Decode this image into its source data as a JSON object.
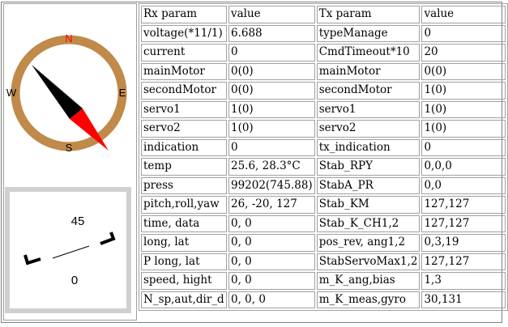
{
  "compass": {
    "north": "N",
    "south": "S",
    "east": "E",
    "west": "W",
    "ring_color": "#c08a4a",
    "needle_north_color": "#000000",
    "needle_south_color": "#ff0000",
    "north_label_color": "#ff0000",
    "heading_deg": -42
  },
  "attitude": {
    "pitch_label": "45",
    "zero_label": "0"
  },
  "table": {
    "headers": [
      "Rx param",
      "value",
      "Tx param",
      "value"
    ],
    "rows": [
      [
        "voltage(*11/1)",
        "6.688",
        "typeManage",
        "0"
      ],
      [
        "current",
        "0",
        "CmdTimeout*10",
        "20"
      ],
      [
        "mainMotor",
        "0(0)",
        "mainMotor",
        "0(0)"
      ],
      [
        "secondMotor",
        "0(0)",
        "secondMotor",
        "1(0)"
      ],
      [
        "servo1",
        "1(0)",
        "servo1",
        "1(0)"
      ],
      [
        "servo2",
        "1(0)",
        "servo2",
        "1(0)"
      ],
      [
        "indication",
        "0",
        "tx_indication",
        "0"
      ],
      [
        "temp",
        "25.6, 28.3°C",
        "Stab_RPY",
        "0,0,0"
      ],
      [
        "press",
        "99202(745.88)",
        "StabA_PR",
        "0,0"
      ],
      [
        "pitch,roll,yaw",
        "26, -20, 127",
        "Stab_KM",
        "127,127"
      ],
      [
        "time, data",
        "0, 0",
        "Stab_K_CH1,2",
        "127,127"
      ],
      [
        "long, lat",
        "0, 0",
        "pos_rev, ang1,2",
        "0,3,19"
      ],
      [
        "P long, lat",
        "0, 0",
        "StabServoMax1,2",
        "127,127"
      ],
      [
        "speed, hight",
        "0, 0",
        "m_K_ang,bias",
        "1,3"
      ],
      [
        "N_sp,aut,dir_d",
        "0, 0, 0",
        "m_K_meas,gyro",
        "30,131"
      ]
    ]
  }
}
